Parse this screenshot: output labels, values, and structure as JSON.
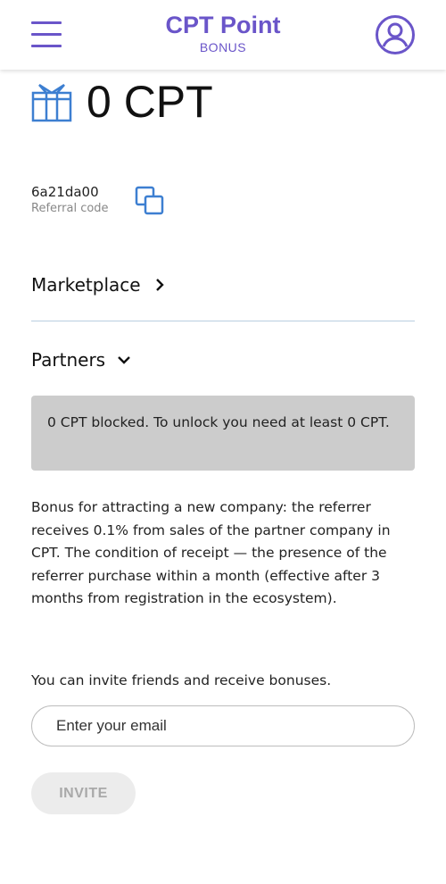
{
  "header": {
    "title": "CPT Point",
    "subtitle": "BONUS",
    "menu_icon": "menu-icon",
    "profile_icon": "user-circle-icon"
  },
  "balance": {
    "icon": "gift-icon",
    "value": "0 CPT"
  },
  "referral": {
    "code": "6a21da00",
    "label": "Referral code",
    "copy_icon": "copy-icon"
  },
  "sections": {
    "marketplace": "Marketplace",
    "partners": "Partners"
  },
  "blocked_notice": "0 CPT blocked. To unlock you need at least 0 CPT.",
  "description": "Bonus for attracting a new company: the referrer receives 0.1% from sales of the partner company in CPT. The condition of receipt — the presence of the referrer purchase within a month (effective after 3 months from registration in the ecosystem).",
  "invite": {
    "text": "You can invite friends and receive bonuses.",
    "email_placeholder": "Enter your email",
    "email_value": "",
    "button_label": "INVITE"
  },
  "colors": {
    "brand": "#6a55c9",
    "icon_blue": "#3d7fd1",
    "notice_bg": "#cccccc"
  }
}
